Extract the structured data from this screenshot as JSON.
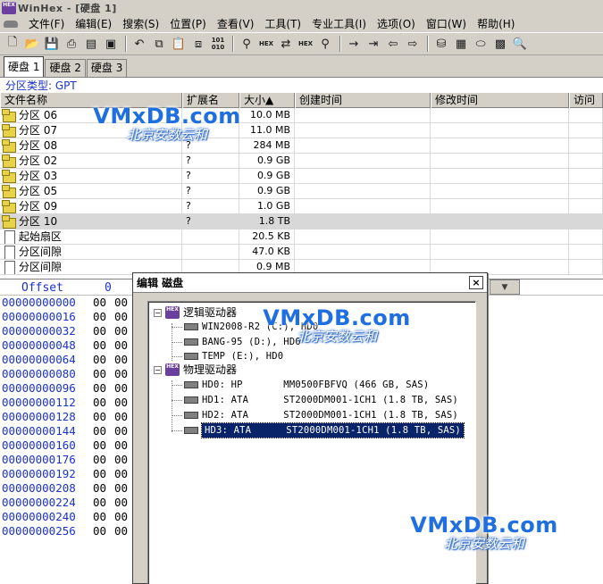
{
  "window": {
    "title": "WinHex - [硬盘 1]",
    "logo": "HEX"
  },
  "menu": [
    {
      "label": "文件(F)"
    },
    {
      "label": "编辑(E)"
    },
    {
      "label": "搜索(S)"
    },
    {
      "label": "位置(P)"
    },
    {
      "label": "查看(V)"
    },
    {
      "label": "工具(T)"
    },
    {
      "label": "专业工具(I)"
    },
    {
      "label": "选项(O)"
    },
    {
      "label": "窗口(W)"
    },
    {
      "label": "帮助(H)"
    }
  ],
  "toolbar": {
    "icons": [
      "new-file-icon",
      "open-icon",
      "save-icon",
      "print-icon",
      "properties-icon",
      "open-disk-icon",
      "undo-icon",
      "copy-icon",
      "paste-icon",
      "paste-special-icon",
      "binary-icon",
      "find-icon",
      "find-hex-icon",
      "replace-icon",
      "replace-hex-icon",
      "find-again-icon",
      "goto-offset-icon",
      "goto-sector-icon",
      "back-icon",
      "forward-icon",
      "disk-editor-icon",
      "ram-editor-icon",
      "disk-tools-icon",
      "calculator-icon",
      "zoom-icon"
    ],
    "binary_label": "101\n010",
    "hex_label": "HEX"
  },
  "tabs": [
    {
      "label": "硬盘 1",
      "active": true
    },
    {
      "label": "硬盘 2",
      "active": false
    },
    {
      "label": "硬盘 3",
      "active": false
    }
  ],
  "partition_type": "分区类型: GPT",
  "file_table": {
    "columns": {
      "name": "文件名称",
      "ext": "扩展名",
      "size": "大小▲",
      "ctime": "创建时间",
      "mtime": "修改时间",
      "atime": "访问"
    },
    "rows": [
      {
        "name": "分区 06",
        "ext": "",
        "size": "10.0 MB",
        "icon": "partition",
        "selected": false
      },
      {
        "name": "分区 07",
        "ext": "",
        "size": "11.0 MB",
        "icon": "partition",
        "selected": false
      },
      {
        "name": "分区 08",
        "ext": "?",
        "size": "284 MB",
        "icon": "partition",
        "selected": false
      },
      {
        "name": "分区 02",
        "ext": "?",
        "size": "0.9 GB",
        "icon": "partition",
        "selected": false
      },
      {
        "name": "分区 03",
        "ext": "?",
        "size": "0.9 GB",
        "icon": "partition",
        "selected": false
      },
      {
        "name": "分区 05",
        "ext": "?",
        "size": "0.9 GB",
        "icon": "partition",
        "selected": false
      },
      {
        "name": "分区 09",
        "ext": "?",
        "size": "1.0 GB",
        "icon": "partition",
        "selected": false
      },
      {
        "name": "分区 10",
        "ext": "?",
        "size": "1.8 TB",
        "icon": "partition",
        "selected": true
      },
      {
        "name": "起始扇区",
        "ext": "",
        "size": "20.5 KB",
        "icon": "document",
        "selected": false
      },
      {
        "name": "分区间隙",
        "ext": "",
        "size": "47.0 KB",
        "icon": "document",
        "selected": false
      },
      {
        "name": "分区间隙",
        "ext": "",
        "size": "0.9 MB",
        "icon": "document",
        "selected": false
      }
    ]
  },
  "hex": {
    "offset_label": "Offset",
    "col0_label": "0",
    "dropdown_glyph": "▼",
    "rows": [
      {
        "addr": "00000000000",
        "b0": "00",
        "b1": "00"
      },
      {
        "addr": "00000000016",
        "b0": "00",
        "b1": "00"
      },
      {
        "addr": "00000000032",
        "b0": "00",
        "b1": "00"
      },
      {
        "addr": "00000000048",
        "b0": "00",
        "b1": "00"
      },
      {
        "addr": "00000000064",
        "b0": "00",
        "b1": "00"
      },
      {
        "addr": "00000000080",
        "b0": "00",
        "b1": "00"
      },
      {
        "addr": "00000000096",
        "b0": "00",
        "b1": "00"
      },
      {
        "addr": "00000000112",
        "b0": "00",
        "b1": "00"
      },
      {
        "addr": "00000000128",
        "b0": "00",
        "b1": "00"
      },
      {
        "addr": "00000000144",
        "b0": "00",
        "b1": "00"
      },
      {
        "addr": "00000000160",
        "b0": "00",
        "b1": "00"
      },
      {
        "addr": "00000000176",
        "b0": "00",
        "b1": "00"
      },
      {
        "addr": "00000000192",
        "b0": "00",
        "b1": "00"
      },
      {
        "addr": "00000000208",
        "b0": "00",
        "b1": "00"
      },
      {
        "addr": "00000000224",
        "b0": "00",
        "b1": "00"
      },
      {
        "addr": "00000000240",
        "b0": "00",
        "b1": "00"
      },
      {
        "addr": "00000000256",
        "b0": "00",
        "b1": "00"
      }
    ]
  },
  "dialog": {
    "title": "编辑 磁盘",
    "close": "×",
    "logical_group": "逻辑驱动器",
    "physical_group": "物理驱动器",
    "logical": [
      {
        "label": "WIN2008-R2 (C:), HD0"
      },
      {
        "label": "BANG-95 (D:), HD0"
      },
      {
        "label": "TEMP (E:), HD0"
      }
    ],
    "physical": [
      {
        "label": "HD0: HP       MM0500FBFVQ (466 GB, SAS)",
        "selected": false
      },
      {
        "label": "HD1: ATA      ST2000DM001-1CH1 (1.8 TB, SAS)",
        "selected": false
      },
      {
        "label": "HD2: ATA      ST2000DM001-1CH1 (1.8 TB, SAS)",
        "selected": false
      },
      {
        "label": "HD3: ATA      ST2000DM001-1CH1 (1.8 TB, SAS)",
        "selected": true
      }
    ],
    "minus": "−"
  },
  "watermark": {
    "line1": "VMxDB.com",
    "line2": "北京安数云和"
  }
}
